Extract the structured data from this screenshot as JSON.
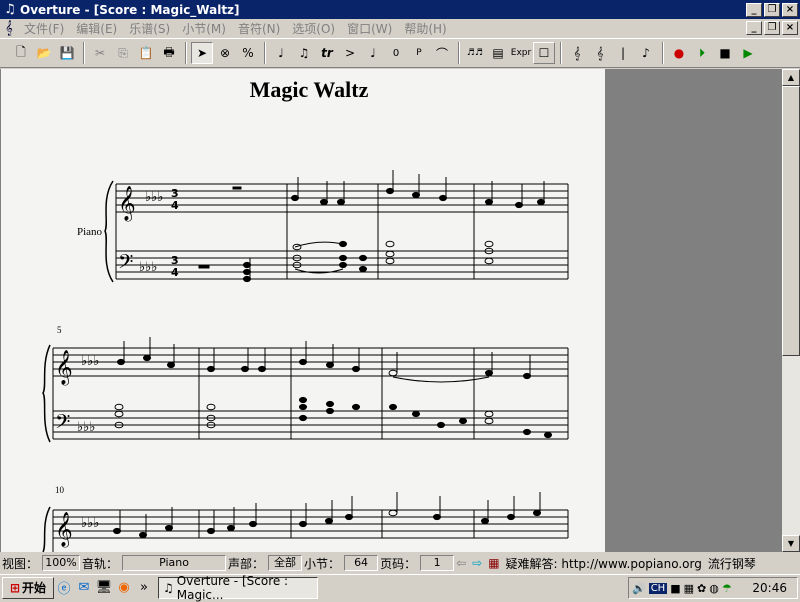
{
  "titlebar": {
    "title": "Overture - [Score : Magic_Waltz]"
  },
  "menu": [
    "文件(F)",
    "编辑(E)",
    "乐谱(S)",
    "小节(M)",
    "音符(N)",
    "选项(O)",
    "窗口(W)",
    "帮助(H)"
  ],
  "toolbar": {
    "text_buttons": [
      "%",
      "tr",
      ">",
      "0",
      "P",
      "Expr"
    ]
  },
  "score": {
    "title": "Magic Waltz",
    "instrument": "Piano",
    "measure_numbers": [
      "5",
      "10"
    ]
  },
  "status": {
    "view_label": "视图：",
    "view_value": "100%",
    "track_label": "音轨：",
    "track_value": "Piano",
    "voice_label": "声部：",
    "voice_value": "全部",
    "measure_label": "小节：",
    "measure_value": "64",
    "page_label": "页码：",
    "page_value": "1",
    "help_text": "疑难解答: http://www.popiano.org",
    "extra_text": "流行钢琴"
  },
  "taskbar": {
    "start_label": "开始",
    "task_label": "Overture - [Score : Magic...",
    "lang": "CH",
    "clock": "20:46"
  },
  "colors": {
    "titlebar": "#0a246a",
    "paper": "#f4f4f2",
    "chrome": "#d4d0c8"
  }
}
